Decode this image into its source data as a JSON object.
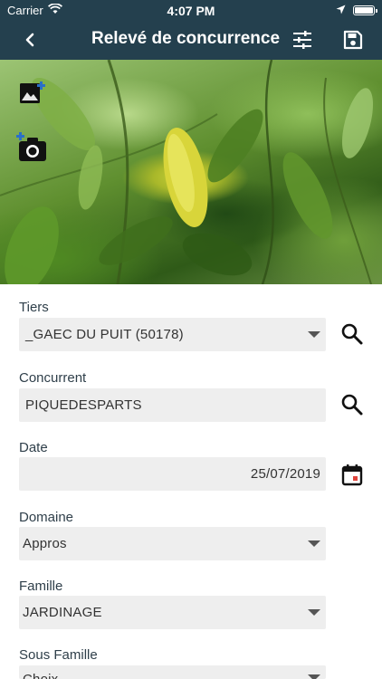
{
  "status": {
    "carrier": "Carrier",
    "time": "4:07 PM"
  },
  "nav": {
    "title": "Relevé de concurrence"
  },
  "fields": {
    "tiers": {
      "label": "Tiers",
      "value": "_GAEC DU PUIT (50178)"
    },
    "concurrent": {
      "label": "Concurrent",
      "value": "PIQUEDESPARTS"
    },
    "date": {
      "label": "Date",
      "value": "25/07/2019"
    },
    "domaine": {
      "label": "Domaine",
      "value": "Appros"
    },
    "famille": {
      "label": "Famille",
      "value": "JARDINAGE"
    },
    "sous_famille": {
      "label": "Sous Famille",
      "value": "Choix..."
    }
  },
  "colors": {
    "header": "#24404e",
    "field_bg": "#eeeeee",
    "accent_red": "#e0443c"
  },
  "icons": [
    "back-chevron-icon",
    "filter-settings-icon",
    "save-icon",
    "add-image-icon",
    "add-photo-camera-icon",
    "search-icon",
    "calendar-icon",
    "dropdown-caret-icon"
  ]
}
